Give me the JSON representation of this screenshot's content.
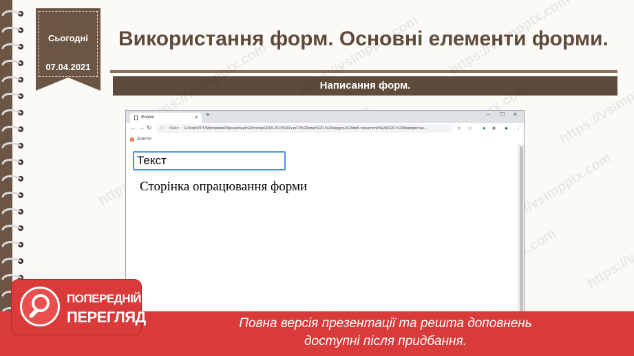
{
  "slide": {
    "title": "Використання форм. Основні елементи форми.",
    "subtitle": "Написання форм.",
    "ribbon": {
      "day_label": "Сьогодні",
      "date": "07.04.2021"
    }
  },
  "browser": {
    "tab_title": "Форми",
    "address_prefix": "Файл",
    "url": "G:/VsimPPT/Матеріали/Презентації%20готові/2018-2019%20н.р/10%20клас%20-%20модуль%20веб-технології/№24%20-%20Використан...",
    "bookmarks_label": "Додатки",
    "icons": [
      "file-icon",
      "close-icon",
      "plus-icon",
      "back-arrow-icon",
      "forward-arrow-icon",
      "reload-icon",
      "info-icon",
      "zoom-icon",
      "star-icon",
      "extension-icon",
      "profile-icon",
      "menu-dots-icon",
      "apps-grid-icon"
    ],
    "window_controls": {
      "minimize": "–",
      "maximize": "☐",
      "close": "✕"
    }
  },
  "page": {
    "input_value": "Текст",
    "text": "Сторінка опрацювання форми"
  },
  "footer": {
    "preview_line1": "ПОПЕРЕДНІЙ",
    "preview_line2": "ПЕРЕГЛЯД",
    "message_line1": "Повна версія презентації та решта доповнень",
    "message_line2": "доступні після придбання."
  },
  "watermark": "https://vsimpptx.com",
  "colors": {
    "brown": "#5e4b3b",
    "accent_red": "#d93a3a",
    "focus_blue": "#4a90e2"
  }
}
